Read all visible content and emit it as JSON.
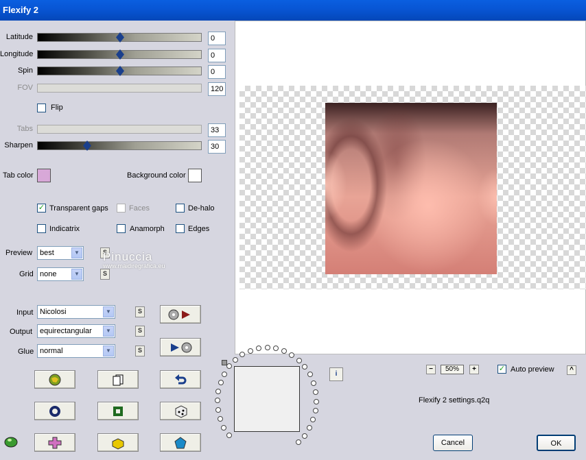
{
  "window": {
    "title": "Flexify 2"
  },
  "sliders": [
    {
      "label": "Latitude",
      "value": "0",
      "level": 0.5,
      "enabled": true
    },
    {
      "label": "Longitude",
      "value": "0",
      "level": 0.5,
      "enabled": true
    },
    {
      "label": "Spin",
      "value": "0",
      "level": 0.5,
      "enabled": true
    },
    {
      "label": "FOV",
      "value": "120",
      "enabled": false
    },
    {
      "label": "Tabs",
      "value": "33",
      "enabled": false
    },
    {
      "label": "Sharpen",
      "value": "30",
      "level": 0.3,
      "enabled": true
    }
  ],
  "flip": {
    "label": "Flip",
    "checked": false
  },
  "colors": {
    "tab_label": "Tab color",
    "tab_value": "#d8a8d8",
    "bg_label": "Background color",
    "bg_value": "#ffffff"
  },
  "options": {
    "transparent_gaps": {
      "label": "Transparent gaps",
      "checked": true
    },
    "faces": {
      "label": "Faces",
      "checked": false
    },
    "de_halo": {
      "label": "De-halo",
      "checked": false
    },
    "indicatrix": {
      "label": "Indicatrix",
      "checked": false
    },
    "anamorph": {
      "label": "Anamorph",
      "checked": false
    },
    "edges": {
      "label": "Edges",
      "checked": false
    }
  },
  "selects": {
    "preview": {
      "label": "Preview",
      "value": "best"
    },
    "grid": {
      "label": "Grid",
      "value": "none"
    },
    "input": {
      "label": "Input",
      "value": "Nicolosi"
    },
    "output": {
      "label": "Output",
      "value": "equirectangular"
    },
    "glue": {
      "label": "Glue",
      "value": "normal"
    }
  },
  "watermark": {
    "line1": "Pinuccia",
    "line2": "www.maidiregrafica.eu"
  },
  "zoom": {
    "value": "50%",
    "minus": "−",
    "plus": "+"
  },
  "auto_preview": {
    "label": "Auto preview",
    "checked": true
  },
  "settings_file": "Flexify 2 settings.q2q",
  "buttons": {
    "cancel": "Cancel",
    "ok": "OK",
    "info": "i",
    "s": "S",
    "scroll_up": "^"
  },
  "check_mark": "✓",
  "accent": "#0a5fe0"
}
